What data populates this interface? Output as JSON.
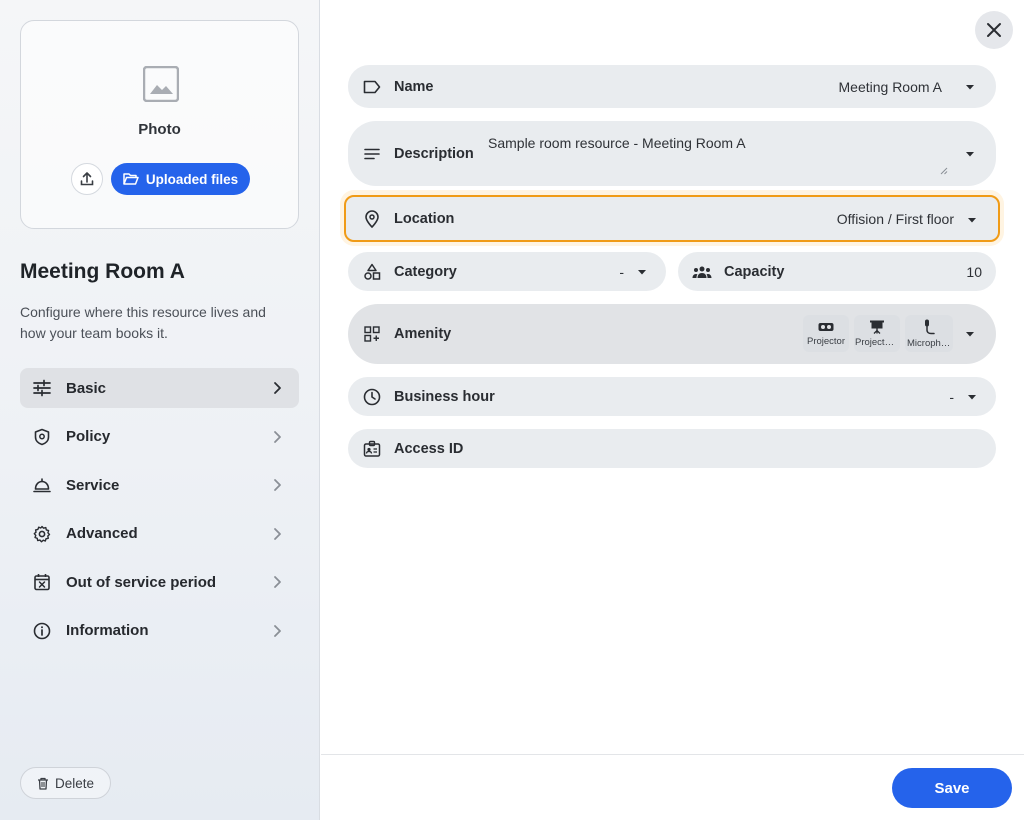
{
  "sidebar": {
    "photo_label": "Photo",
    "uploaded_files_label": "Uploaded files",
    "room_title": "Meeting Room A",
    "room_description": "Configure where this resource lives and how your team books it.",
    "nav_items": [
      {
        "label": "Basic",
        "icon": "sliders-icon",
        "active": true
      },
      {
        "label": "Policy",
        "icon": "shield-icon",
        "active": false
      },
      {
        "label": "Service",
        "icon": "service-bell-icon",
        "active": false
      },
      {
        "label": "Advanced",
        "icon": "gear-icon",
        "active": false
      },
      {
        "label": "Out of service period",
        "icon": "calendar-x-icon",
        "active": false
      },
      {
        "label": "Information",
        "icon": "info-icon",
        "active": false
      }
    ],
    "delete_label": "Delete"
  },
  "form": {
    "name": {
      "label": "Name",
      "value": "Meeting Room A"
    },
    "description": {
      "label": "Description",
      "value": "Sample room resource - Meeting Room A"
    },
    "location": {
      "label": "Location",
      "value": "Offision / First floor"
    },
    "category": {
      "label": "Category",
      "value": "-"
    },
    "capacity": {
      "label": "Capacity",
      "value": "10"
    },
    "amenity": {
      "label": "Amenity",
      "chips": [
        "Projector",
        "Projector screen",
        "Microphone"
      ]
    },
    "business_hour": {
      "label": "Business hour",
      "value": "-"
    },
    "access_id": {
      "label": "Access ID",
      "value": ""
    }
  },
  "footer": {
    "save_label": "Save"
  },
  "colors": {
    "accent": "#2563eb",
    "highlight": "#f09b17",
    "field_bg": "#e9ecef"
  }
}
